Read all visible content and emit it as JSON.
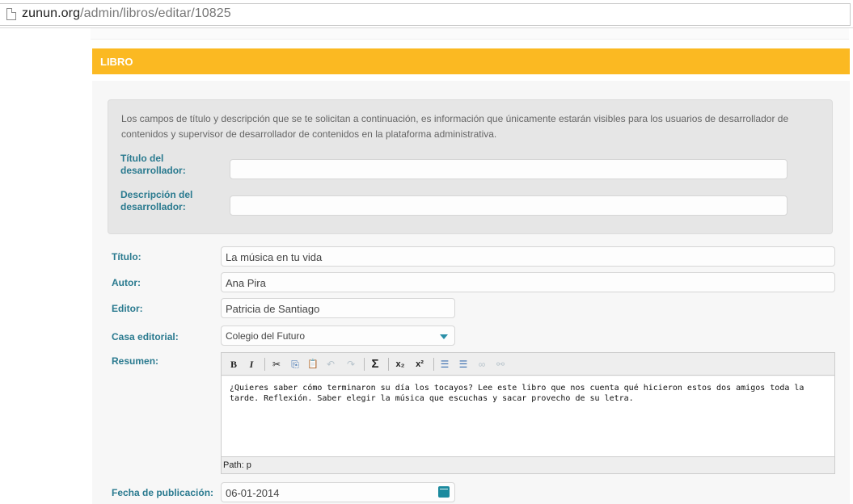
{
  "browser": {
    "url_host": "zunun.org",
    "url_path": "/admin/libros/editar/10825"
  },
  "section": {
    "title": "LIBRO"
  },
  "info_box": {
    "text": "Los campos de título y descripción que se te solicitan a continuación, es información que únicamente estarán visibles para los usuarios de desarrollador de contenidos y supervisor de desarrollador de contenidos en la plataforma administrativa.",
    "dev_title_label": "Título del desarrollador:",
    "dev_title_value": "",
    "dev_desc_label": "Descripción del desarrollador:",
    "dev_desc_value": ""
  },
  "form": {
    "titulo_label": "Título:",
    "titulo_value": "La música en tu vida",
    "autor_label": "Autor:",
    "autor_value": "Ana Pira",
    "editor_label": "Editor:",
    "editor_value": "Patricia de Santiago",
    "casa_label": "Casa editorial:",
    "casa_value": "Colegio del Futuro",
    "resumen_label": "Resumen:",
    "resumen_text": "¿Quieres saber cómo terminaron su día los tocayos? Lee este libro que nos cuenta qué hicieron estos dos amigos toda la tarde. Reflexión. Saber elegir la música que escuchas y sacar provecho de su letra.",
    "path_text": "Path: p",
    "fecha_label": "Fecha de publicación:",
    "fecha_value": "06-01-2014"
  },
  "toolbar": {
    "bold": "B",
    "italic": "I",
    "cut": "✂",
    "copy": "⎘",
    "paste": "📋",
    "undo": "↶",
    "redo": "↷",
    "sum": "Σ",
    "sub": "x₂",
    "sup": "x²",
    "ol": "☰",
    "ul": "☰",
    "link": "∞",
    "unlink": "⚯"
  }
}
